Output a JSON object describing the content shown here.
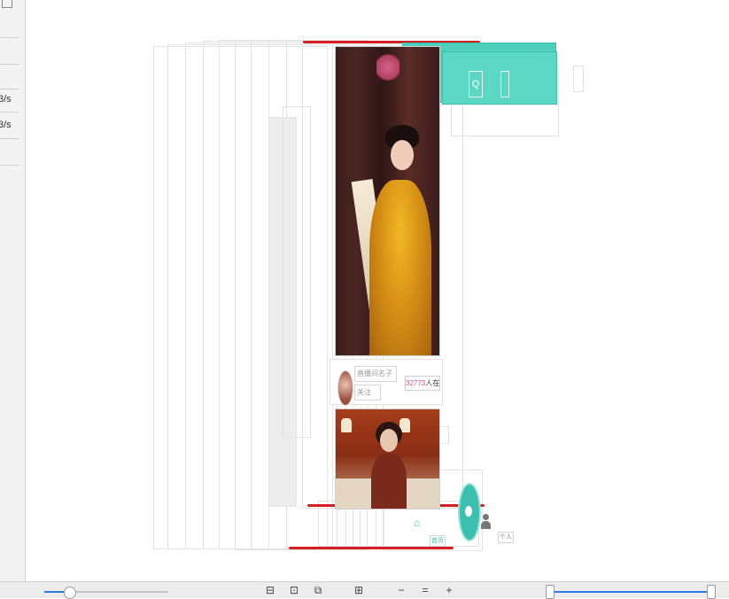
{
  "sidebar": {
    "readouts": [
      "3/s",
      "3/s"
    ]
  },
  "preview": {
    "viewer_count": "32773",
    "viewer_suffix": "人在看",
    "name_placeholder": "直播间名子",
    "follow_label": "关注",
    "search_glyph": "Q",
    "mine_label": "个人",
    "home_tab": "首页"
  },
  "toolbar": {
    "layer_spacing_level": 0.2,
    "range_start": 0.0,
    "range_end": 1.0,
    "buttons": [
      "layout-a",
      "layout-b",
      "layout-c",
      "grid",
      "zoom-out",
      "zoom-reset",
      "zoom-in"
    ],
    "zoom_out_label": "−",
    "zoom_reset_label": "=",
    "zoom_in_label": "+",
    "grid_label": "⊞"
  },
  "colors": {
    "accent_teal": "#4fd0bd",
    "slider_blue": "#2f7be5",
    "highlight_red": "#d42020",
    "viewer_pink": "#d64a86"
  }
}
